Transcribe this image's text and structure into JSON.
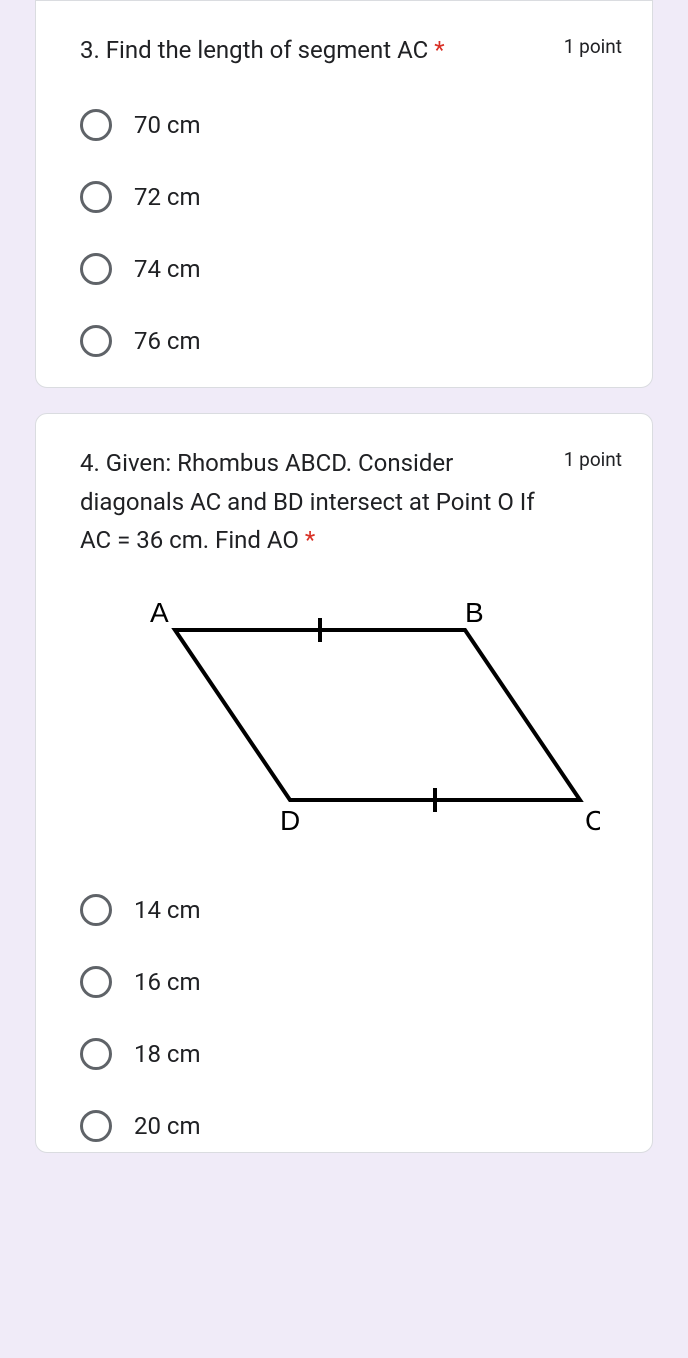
{
  "question3": {
    "text": "3. Find the length of  segment AC",
    "required": "*",
    "points": "1 point",
    "options": [
      "70 cm",
      "72 cm",
      "74 cm",
      "76 cm"
    ]
  },
  "question4": {
    "text": "4. Given: Rhombus ABCD. Consider  diagonals  AC  and  BD intersect at Point  O If  AC = 36 cm. Find AO",
    "required": "*",
    "points": "1 point",
    "labels": {
      "A": "A",
      "B": "B",
      "C": "C",
      "D": "D"
    },
    "options": [
      "14 cm",
      "16 cm",
      "18 cm",
      "20 cm"
    ]
  }
}
